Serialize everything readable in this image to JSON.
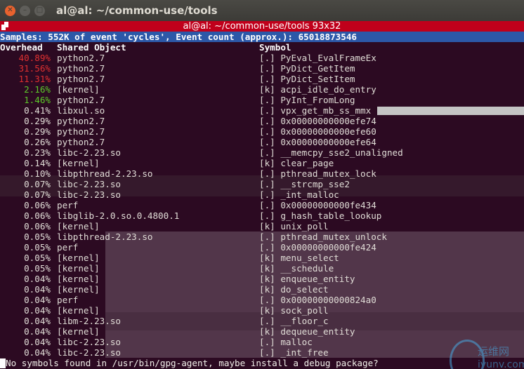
{
  "window": {
    "title": "al@al: ~/common-use/tools"
  },
  "screen_status": "al@al: ~/common-use/tools 93x32",
  "perf": {
    "summary": "Samples: 552K of event 'cycles', Event count (approx.): 65018873546",
    "columns": [
      "Overhead",
      "Shared Object",
      "Symbol"
    ],
    "rows": [
      {
        "overhead": "40.89%",
        "object": "python2.7",
        "symbol": "[.] PyEval_EvalFrameEx",
        "level": "red"
      },
      {
        "overhead": "31.56%",
        "object": "python2.7",
        "symbol": "[.] PyDict_GetItem",
        "level": "red"
      },
      {
        "overhead": "11.31%",
        "object": "python2.7",
        "symbol": "[.] PyDict_SetItem",
        "level": "red"
      },
      {
        "overhead": "2.16%",
        "object": "[kernel]",
        "symbol": "[k] acpi_idle_do_entry",
        "level": "green"
      },
      {
        "overhead": "1.46%",
        "object": "python2.7",
        "symbol": "[.] PyInt_FromLong",
        "level": "green"
      },
      {
        "overhead": "0.41%",
        "object": "libxul.so",
        "symbol": "[.] vpx_get_mb_ss_mmx",
        "level": "white"
      },
      {
        "overhead": "0.29%",
        "object": "python2.7",
        "symbol": "[.] 0x00000000000efe74",
        "level": "white"
      },
      {
        "overhead": "0.29%",
        "object": "python2.7",
        "symbol": "[.] 0x00000000000efe60",
        "level": "white"
      },
      {
        "overhead": "0.26%",
        "object": "python2.7",
        "symbol": "[.] 0x00000000000efe64",
        "level": "white"
      },
      {
        "overhead": "0.23%",
        "object": "libc-2.23.so",
        "symbol": "[.] __memcpy_sse2_unaligned",
        "level": "white"
      },
      {
        "overhead": "0.14%",
        "object": "[kernel]",
        "symbol": "[k] clear_page",
        "level": "white"
      },
      {
        "overhead": "0.10%",
        "object": "libpthread-2.23.so",
        "symbol": "[.] pthread_mutex_lock",
        "level": "white"
      },
      {
        "overhead": "0.07%",
        "object": "libc-2.23.so",
        "symbol": "[.] __strcmp_sse2",
        "level": "white"
      },
      {
        "overhead": "0.07%",
        "object": "libc-2.23.so",
        "symbol": "[.] _int_malloc",
        "level": "white"
      },
      {
        "overhead": "0.06%",
        "object": "perf",
        "symbol": "[.] 0x00000000000fe434",
        "level": "white"
      },
      {
        "overhead": "0.06%",
        "object": "libglib-2.0.so.0.4800.1",
        "symbol": "[.] g_hash_table_lookup",
        "level": "white"
      },
      {
        "overhead": "0.06%",
        "object": "[kernel]",
        "symbol": "[k] unix_poll",
        "level": "white"
      },
      {
        "overhead": "0.05%",
        "object": "libpthread-2.23.so",
        "symbol": "[.] pthread_mutex_unlock",
        "level": "white"
      },
      {
        "overhead": "0.05%",
        "object": "perf",
        "symbol": "[.] 0x00000000000fe424",
        "level": "white"
      },
      {
        "overhead": "0.05%",
        "object": "[kernel]",
        "symbol": "[k] menu_select",
        "level": "white"
      },
      {
        "overhead": "0.05%",
        "object": "[kernel]",
        "symbol": "[k] __schedule",
        "level": "white"
      },
      {
        "overhead": "0.04%",
        "object": "[kernel]",
        "symbol": "[k] enqueue_entity",
        "level": "white"
      },
      {
        "overhead": "0.04%",
        "object": "[kernel]",
        "symbol": "[k] do_select",
        "level": "white"
      },
      {
        "overhead": "0.04%",
        "object": "perf",
        "symbol": "[.] 0x00000000000824a0",
        "level": "white"
      },
      {
        "overhead": "0.04%",
        "object": "[kernel]",
        "symbol": "[k] sock_poll",
        "level": "white"
      },
      {
        "overhead": "0.04%",
        "object": "libm-2.23.so",
        "symbol": "[.] __floor_c",
        "level": "white"
      },
      {
        "overhead": "0.04%",
        "object": "[kernel]",
        "symbol": "[k] dequeue_entity",
        "level": "white"
      },
      {
        "overhead": "0.04%",
        "object": "libc-2.23.so",
        "symbol": "[.] malloc",
        "level": "white"
      },
      {
        "overhead": "0.04%",
        "object": "libc-2.23.so",
        "symbol": "[.] _int_free",
        "level": "white"
      }
    ],
    "footer": "No symbols found in /usr/bin/gpg-agent, maybe install a debug package?"
  },
  "watermark": {
    "line1": "运维网",
    "line2": "iyunv.com"
  },
  "colors": {
    "terminal_bg": "#2c0a22",
    "header_bar": "#2c58a8",
    "status_bar": "#c0001b",
    "high_overhead": "#e03030",
    "mid_overhead": "#5cc82a"
  }
}
